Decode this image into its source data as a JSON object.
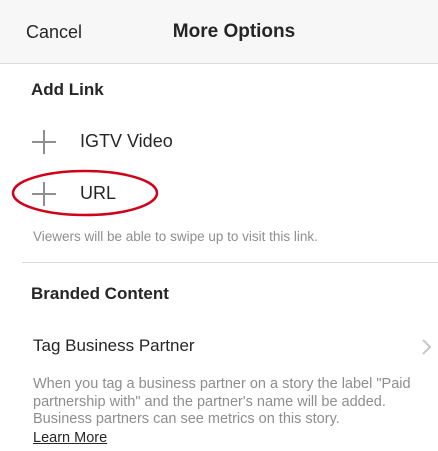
{
  "header": {
    "cancel_label": "Cancel",
    "title": "More Options"
  },
  "add_link": {
    "heading": "Add Link",
    "items": [
      {
        "label": "IGTV Video",
        "icon": "plus-icon"
      },
      {
        "label": "URL",
        "icon": "plus-icon"
      }
    ],
    "hint": "Viewers will be able to swipe up to visit this link."
  },
  "branded_content": {
    "heading": "Branded Content",
    "tag_partner_label": "Tag Business Partner",
    "description": "When you tag a business partner on a story the label \"Paid partnership with\" and the partner's name will be added. Business partners can see metrics on this story.",
    "learn_more": "Learn More"
  },
  "colors": {
    "text": "#262626",
    "secondary": "#8e8e8e",
    "header_bg": "#f7f7f7",
    "annotation": "#d0021b"
  }
}
